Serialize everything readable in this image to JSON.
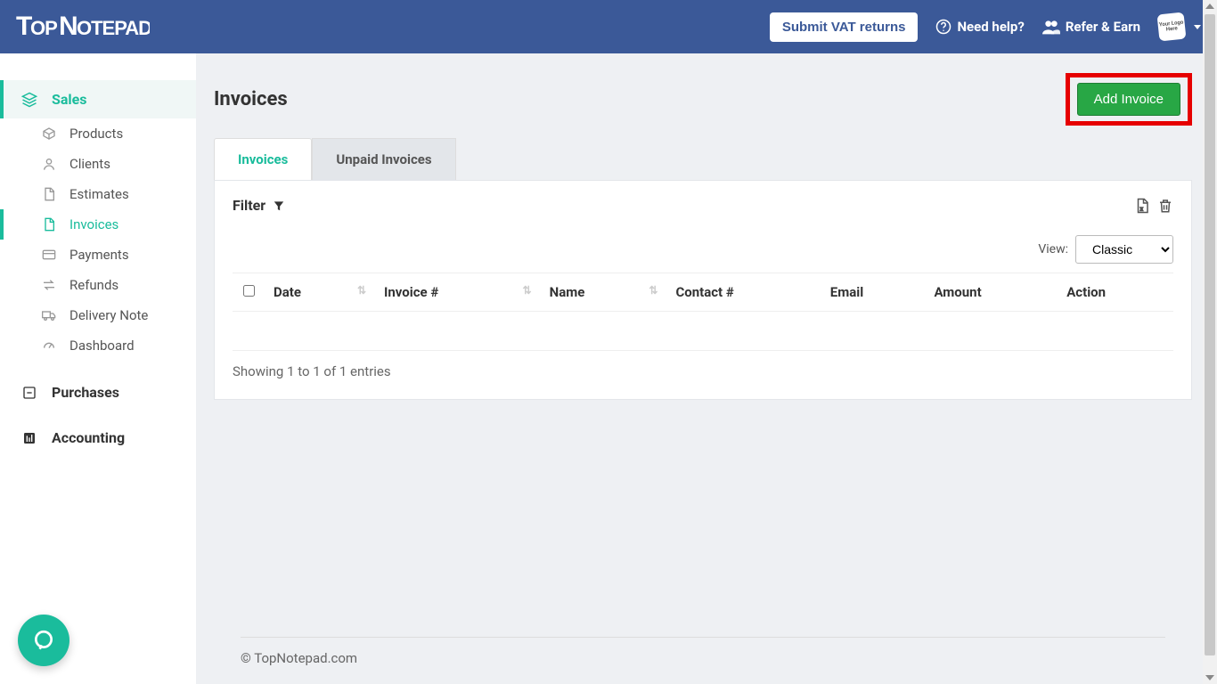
{
  "brand": "TopNotepad",
  "topbar": {
    "submit_vat": "Submit VAT returns",
    "need_help": "Need help?",
    "refer_earn": "Refer & Earn",
    "logo_placeholder": "Your Logo Here"
  },
  "sidebar": {
    "sections": [
      {
        "label": "Sales",
        "active": true
      },
      {
        "label": "Purchases",
        "active": false
      },
      {
        "label": "Accounting",
        "active": false
      }
    ],
    "sales_items": [
      {
        "label": "Products"
      },
      {
        "label": "Clients"
      },
      {
        "label": "Estimates"
      },
      {
        "label": "Invoices",
        "active": true
      },
      {
        "label": "Payments"
      },
      {
        "label": "Refunds"
      },
      {
        "label": "Delivery Note"
      },
      {
        "label": "Dashboard"
      }
    ]
  },
  "page": {
    "title": "Invoices",
    "add_button": "Add Invoice"
  },
  "tabs": [
    {
      "label": "Invoices",
      "active": true
    },
    {
      "label": "Unpaid Invoices",
      "active": false
    }
  ],
  "filter_label": "Filter",
  "view": {
    "label": "View:",
    "selected": "Classic",
    "options": [
      "Classic"
    ]
  },
  "table": {
    "columns": [
      "Date",
      "Invoice #",
      "Name",
      "Contact #",
      "Email",
      "Amount",
      "Action"
    ]
  },
  "showing_text": "Showing 1 to 1 of 1 entries",
  "footer": "© TopNotepad.com"
}
